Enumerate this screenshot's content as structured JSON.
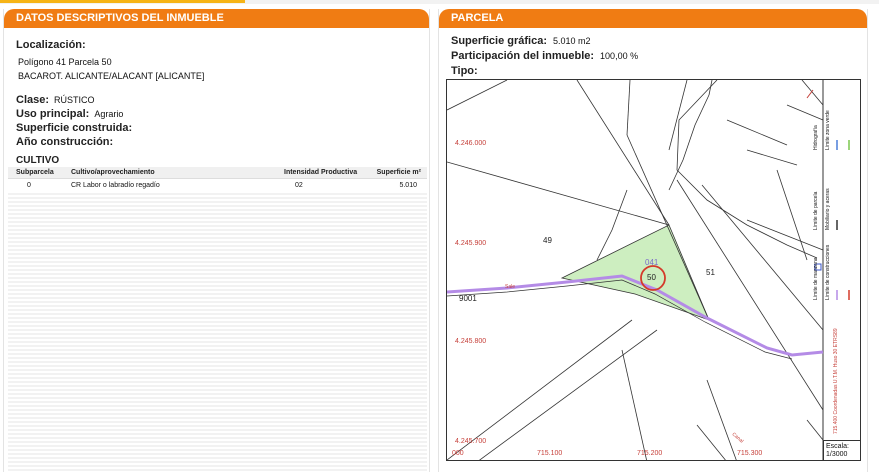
{
  "left_panel": {
    "header": "DATOS DESCRIPTIVOS DEL INMUEBLE",
    "localizacion": {
      "label": "Localización:",
      "line1": "Polígono 41 Parcela 50",
      "line2": "BACAROT. ALICANTE/ALACANT [ALICANTE]"
    },
    "clase": {
      "label": "Clase:",
      "value": "RÚSTICO"
    },
    "uso": {
      "label": "Uso principal:",
      "value": "Agrario"
    },
    "superficie": {
      "label": "Superficie construida:",
      "value": ""
    },
    "ano": {
      "label": "Año construcción:",
      "value": ""
    },
    "cultivo": {
      "title": "CULTIVO",
      "headers": [
        "Subparcela",
        "Cultivo/aprovechamiento",
        "Intensidad Productiva",
        "Superficie m²"
      ],
      "rows": [
        [
          "0",
          "CR Labor o labradío regadío",
          "02",
          "5.010"
        ]
      ]
    }
  },
  "right_panel": {
    "header": "PARCELA",
    "superficie_grafica": {
      "label": "Superficie gráfica:",
      "value": "5.010 m2"
    },
    "participacion": {
      "label": "Participación del inmueble:",
      "value": "100,00 %"
    },
    "tipo": {
      "label": "Tipo:",
      "value": ""
    },
    "map": {
      "coords_y": [
        "4.246.000",
        "4.245.900",
        "4.245.800",
        "4.245.700"
      ],
      "coords_x": [
        "715.100",
        "715.200",
        "715.300"
      ],
      "x_edge_label": "000",
      "parcels": [
        "49",
        "50",
        "51"
      ],
      "parcel_sub": "041",
      "road_label": "9001",
      "road_small": "Sale",
      "street_label": "Canal",
      "legend": {
        "a": "Hidrografía",
        "b": "Límite zona verde",
        "c": "Límite de parcela",
        "d": "Mobiliario y aceras",
        "e": "Límite de manzana",
        "f": "Límite de construcciones",
        "coords_note": "715.400 Coordenadas U.T.M. Huso 30 ETRS89"
      },
      "escala_label": "Escala:",
      "escala_value": "1/3000",
      "colors": {
        "parcel_fill": "#cdeec0",
        "road": "#b48be6",
        "highlight_circle": "#d43a2a",
        "coords": "#c6403a"
      }
    }
  },
  "colors": {
    "header_orange": "#f07c13",
    "top_accent": "#f6b417"
  }
}
